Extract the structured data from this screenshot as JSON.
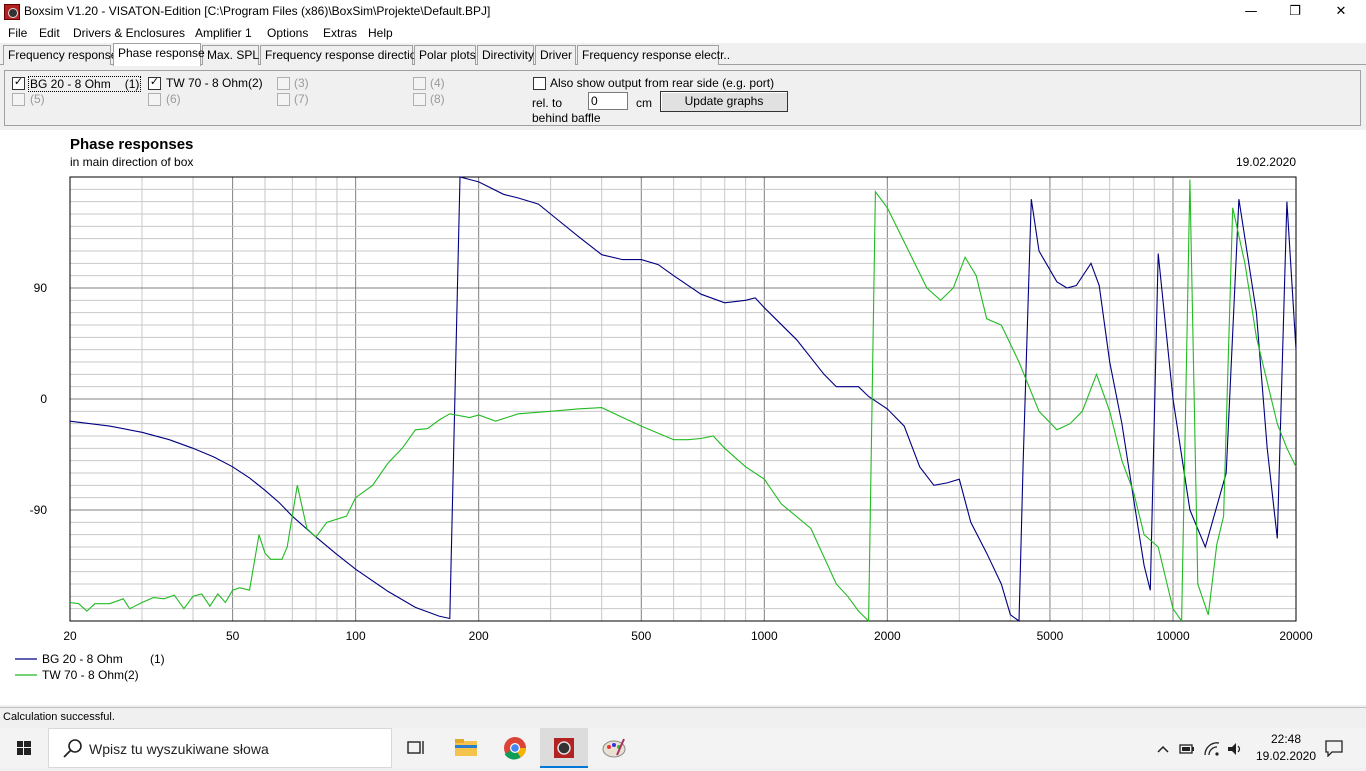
{
  "window": {
    "title": "Boxsim V1.20 - VISATON-Edition [C:\\Program Files (x86)\\BoxSim\\Projekte\\Default.BPJ]",
    "minimize_glyph": "—",
    "maximize_glyph": "❐",
    "close_glyph": "✕"
  },
  "menu": [
    "File",
    "Edit",
    "Drivers & Enclosures",
    "Amplifier 1",
    "Options",
    "Extras",
    "Help"
  ],
  "tabs": [
    {
      "label": "Frequency response.",
      "active": false
    },
    {
      "label": "Phase response",
      "active": true
    },
    {
      "label": "Max. SPL",
      "active": false
    },
    {
      "label": "Frequency response directions",
      "active": false
    },
    {
      "label": "Polar plots",
      "active": false
    },
    {
      "label": "Directivity",
      "active": false
    },
    {
      "label": "Driver",
      "active": false
    },
    {
      "label": "Frequency response electr..",
      "active": false
    }
  ],
  "drivers": [
    {
      "label": "BG 20 - 8 Ohm",
      "index": "(1)",
      "checked": true
    },
    {
      "label": "TW 70 - 8 Ohm(2)",
      "index": "",
      "checked": true
    },
    {
      "label": "(3)",
      "index": "",
      "checked": false
    },
    {
      "label": "(4)",
      "index": "",
      "checked": false
    },
    {
      "label": "(5)",
      "index": "",
      "checked": false
    },
    {
      "label": "(6)",
      "index": "",
      "checked": false
    },
    {
      "label": "(7)",
      "index": "",
      "checked": false
    },
    {
      "label": "(8)",
      "index": "",
      "checked": false
    }
  ],
  "options": {
    "rear_side_label": "Also show output from rear side (e.g. port)",
    "rear_side_checked": false,
    "rel_to_label": "rel. to",
    "behind_baffle_label": "behind baffle",
    "distance_value": "0",
    "unit_label": "cm",
    "update_button_label": "Update graphs"
  },
  "chart_data": {
    "type": "line",
    "title": "Phase responses",
    "subtitle": "in main direction of box",
    "date": "19.02.2020",
    "x_scale": "log",
    "xlim": [
      20,
      20000
    ],
    "ylim": [
      -180,
      180
    ],
    "x_ticks": [
      20,
      50,
      100,
      200,
      500,
      1000,
      2000,
      5000,
      10000,
      20000
    ],
    "y_ticks": [
      90,
      0,
      -90
    ],
    "grid": true,
    "legend_position": "bottom-left",
    "series": [
      {
        "name": "BG 20 - 8 Ohm",
        "legend_index": "(1)",
        "color": "#000080",
        "points": [
          [
            20,
            -18
          ],
          [
            25,
            -22
          ],
          [
            30,
            -27
          ],
          [
            35,
            -33
          ],
          [
            40,
            -40
          ],
          [
            45,
            -47
          ],
          [
            50,
            -55
          ],
          [
            55,
            -64
          ],
          [
            60,
            -74
          ],
          [
            65,
            -84
          ],
          [
            70,
            -95
          ],
          [
            80,
            -112
          ],
          [
            90,
            -126
          ],
          [
            100,
            -138
          ],
          [
            120,
            -156
          ],
          [
            140,
            -169
          ],
          [
            160,
            -176
          ],
          [
            170,
            -178
          ],
          [
            180,
            180
          ],
          [
            190,
            178
          ],
          [
            200,
            176
          ],
          [
            230,
            166
          ],
          [
            250,
            163
          ],
          [
            280,
            158
          ],
          [
            300,
            150
          ],
          [
            350,
            132
          ],
          [
            400,
            117
          ],
          [
            450,
            113
          ],
          [
            500,
            113
          ],
          [
            550,
            109
          ],
          [
            600,
            100
          ],
          [
            700,
            85
          ],
          [
            800,
            78
          ],
          [
            900,
            80
          ],
          [
            950,
            82
          ],
          [
            1000,
            74
          ],
          [
            1200,
            48
          ],
          [
            1400,
            20
          ],
          [
            1500,
            10
          ],
          [
            1700,
            10
          ],
          [
            1800,
            2
          ],
          [
            2000,
            -8
          ],
          [
            2200,
            -22
          ],
          [
            2400,
            -55
          ],
          [
            2600,
            -70
          ],
          [
            2800,
            -68
          ],
          [
            3000,
            -65
          ],
          [
            3200,
            -100
          ],
          [
            3500,
            -125
          ],
          [
            3800,
            -150
          ],
          [
            4000,
            -175
          ],
          [
            4200,
            -180
          ],
          [
            4300,
            -50
          ],
          [
            4500,
            162
          ],
          [
            4700,
            120
          ],
          [
            5200,
            95
          ],
          [
            5500,
            90
          ],
          [
            5800,
            92
          ],
          [
            6300,
            110
          ],
          [
            6600,
            92
          ],
          [
            7000,
            30
          ],
          [
            7500,
            -20
          ],
          [
            8000,
            -80
          ],
          [
            8500,
            -135
          ],
          [
            8800,
            -155
          ],
          [
            9200,
            118
          ],
          [
            10000,
            0
          ],
          [
            11000,
            -90
          ],
          [
            12000,
            -120
          ],
          [
            13500,
            -60
          ],
          [
            14500,
            162
          ],
          [
            16000,
            70
          ],
          [
            17000,
            -40
          ],
          [
            18000,
            -113
          ],
          [
            19000,
            160
          ],
          [
            20000,
            40
          ]
        ]
      },
      {
        "name": "TW 70 - 8 Ohm(2)",
        "legend_index": "",
        "color": "#22bb22",
        "points": [
          [
            20,
            -165
          ],
          [
            21,
            -166
          ],
          [
            22,
            -172
          ],
          [
            23,
            -166
          ],
          [
            25,
            -166
          ],
          [
            27,
            -162
          ],
          [
            28,
            -170
          ],
          [
            30,
            -165
          ],
          [
            32,
            -161
          ],
          [
            34,
            -162
          ],
          [
            36,
            -159
          ],
          [
            38,
            -170
          ],
          [
            40,
            -160
          ],
          [
            42,
            -158
          ],
          [
            44,
            -168
          ],
          [
            46,
            -158
          ],
          [
            48,
            -165
          ],
          [
            50,
            -155
          ],
          [
            52,
            -153
          ],
          [
            55,
            -155
          ],
          [
            58,
            -110
          ],
          [
            60,
            -125
          ],
          [
            62,
            -130
          ],
          [
            66,
            -130
          ],
          [
            68,
            -120
          ],
          [
            72,
            -70
          ],
          [
            76,
            -105
          ],
          [
            80,
            -112
          ],
          [
            85,
            -100
          ],
          [
            95,
            -95
          ],
          [
            100,
            -80
          ],
          [
            110,
            -70
          ],
          [
            120,
            -52
          ],
          [
            130,
            -40
          ],
          [
            140,
            -25
          ],
          [
            150,
            -24
          ],
          [
            160,
            -17
          ],
          [
            170,
            -12
          ],
          [
            190,
            -15
          ],
          [
            200,
            -13
          ],
          [
            220,
            -18
          ],
          [
            250,
            -12
          ],
          [
            300,
            -10
          ],
          [
            350,
            -8
          ],
          [
            400,
            -7
          ],
          [
            450,
            -15
          ],
          [
            500,
            -22
          ],
          [
            600,
            -33
          ],
          [
            650,
            -33
          ],
          [
            700,
            -32
          ],
          [
            750,
            -30
          ],
          [
            800,
            -40
          ],
          [
            900,
            -55
          ],
          [
            1000,
            -65
          ],
          [
            1100,
            -85
          ],
          [
            1300,
            -105
          ],
          [
            1500,
            -150
          ],
          [
            1600,
            -160
          ],
          [
            1700,
            -172
          ],
          [
            1800,
            -180
          ],
          [
            1870,
            168
          ],
          [
            2000,
            155
          ],
          [
            2500,
            90
          ],
          [
            2700,
            80
          ],
          [
            2900,
            90
          ],
          [
            3100,
            115
          ],
          [
            3300,
            100
          ],
          [
            3500,
            65
          ],
          [
            3800,
            60
          ],
          [
            4200,
            30
          ],
          [
            4700,
            -10
          ],
          [
            5200,
            -25
          ],
          [
            5600,
            -20
          ],
          [
            6000,
            -10
          ],
          [
            6500,
            20
          ],
          [
            7000,
            -10
          ],
          [
            7500,
            -50
          ],
          [
            8000,
            -75
          ],
          [
            8500,
            -110
          ],
          [
            9200,
            -120
          ],
          [
            10000,
            -170
          ],
          [
            10500,
            -180
          ],
          [
            11000,
            178
          ],
          [
            11500,
            -150
          ],
          [
            12200,
            -175
          ],
          [
            12800,
            -118
          ],
          [
            13300,
            -95
          ],
          [
            14000,
            155
          ],
          [
            15000,
            110
          ],
          [
            16000,
            50
          ],
          [
            18000,
            -20
          ],
          [
            19000,
            -40
          ],
          [
            20000,
            -55
          ]
        ]
      }
    ]
  },
  "status": {
    "text": "Calculation successful."
  },
  "taskbar": {
    "search_placeholder": "Wpisz tu wyszukiwane słowa",
    "time": "22:48",
    "date": "19.02.2020",
    "accent": "#0078d7"
  }
}
